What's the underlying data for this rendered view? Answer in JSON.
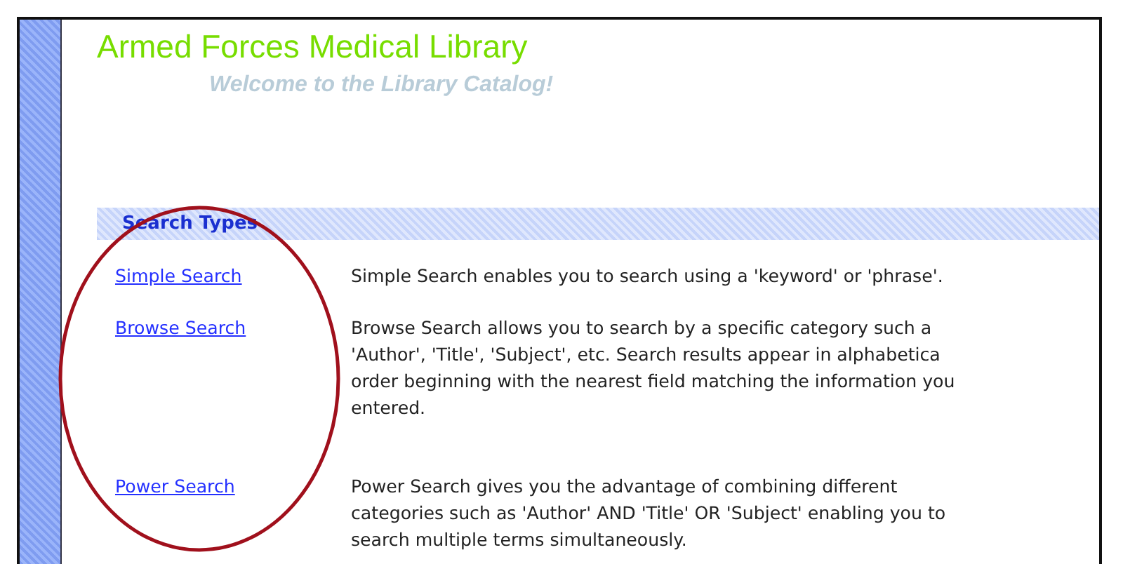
{
  "header": {
    "title": "Armed Forces Medical Library",
    "subtitle": "Welcome to the Library Catalog!"
  },
  "section": {
    "heading": "Search Types"
  },
  "search_types": [
    {
      "link": "Simple Search",
      "description_lines": [
        "Simple Search enables you to search using a 'keyword' or 'phrase'."
      ]
    },
    {
      "link": "Browse Search",
      "description_lines": [
        "Browse Search allows you to search by a specific category such a",
        "'Author', 'Title', 'Subject', etc. Search results appear in alphabetica",
        "order beginning with the nearest field matching the information you",
        "entered."
      ]
    },
    {
      "link": "Power Search",
      "description_lines": [
        "Power Search gives you the advantage of combining different",
        "categories such as 'Author' AND 'Title' OR 'Subject' enabling you to",
        "search multiple terms simultaneously."
      ]
    }
  ]
}
